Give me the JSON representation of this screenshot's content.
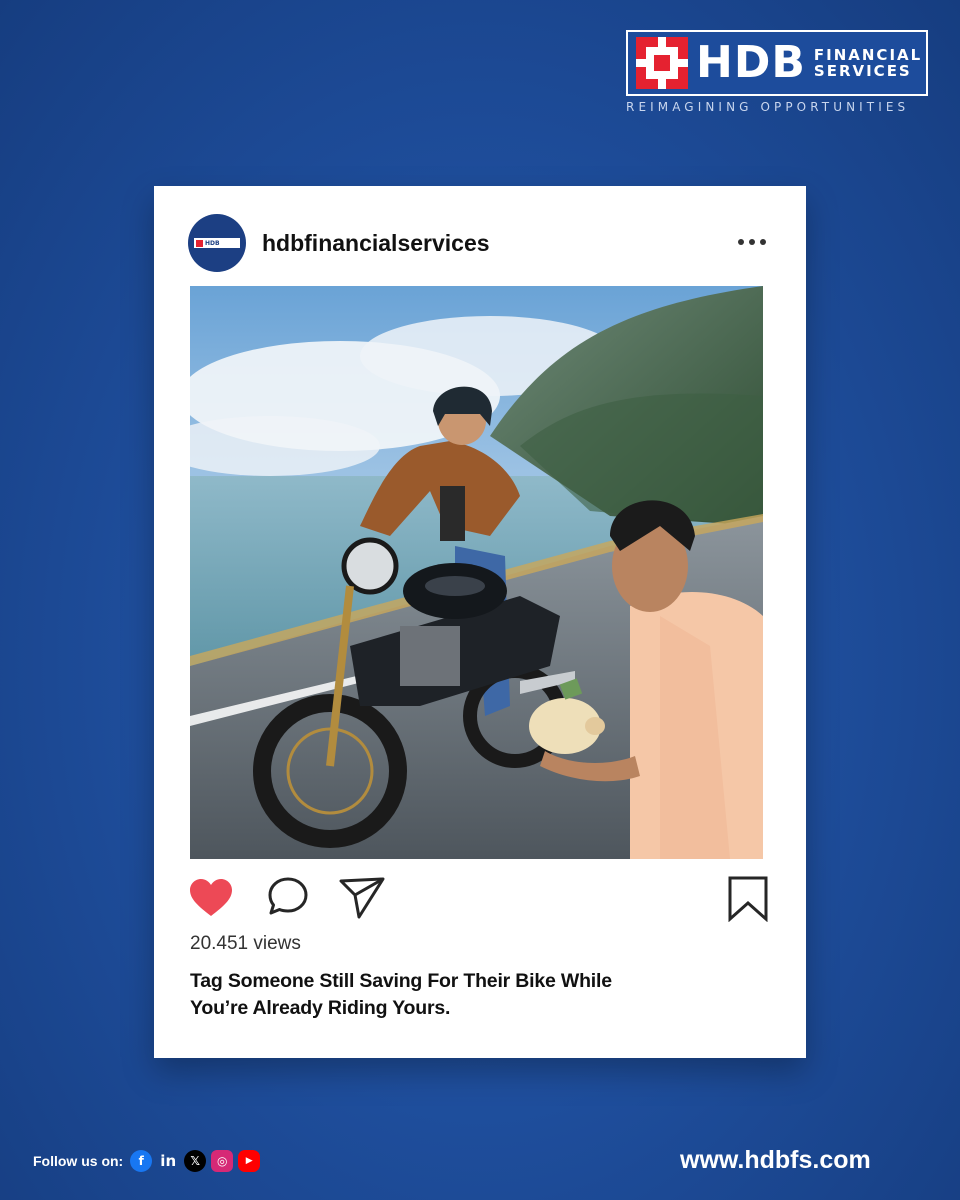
{
  "brand": {
    "logo_text": "HDB",
    "logo_sub_line1": "FINANCIAL",
    "logo_sub_line2": "SERVICES",
    "tagline": "REIMAGINING OPPORTUNITIES",
    "accent_red": "#e52230",
    "brand_blue": "#1d4c9c"
  },
  "post": {
    "username": "hdbfinancialservices",
    "avatar_icon": "hdb-logo-avatar",
    "views": "20.451 views",
    "caption_line1": "Tag Someone Still Saving For Their Bike While",
    "caption_line2": "You’re Already Riding Yours.",
    "like_color": "#ed4956",
    "photo_description_icon": "motorcycle-photo"
  },
  "footer": {
    "follow_label": "Follow us on:",
    "social_icons": [
      "facebook-icon",
      "linkedin-icon",
      "x-icon",
      "instagram-icon",
      "youtube-icon"
    ],
    "website": "www.hdbfs.com"
  }
}
